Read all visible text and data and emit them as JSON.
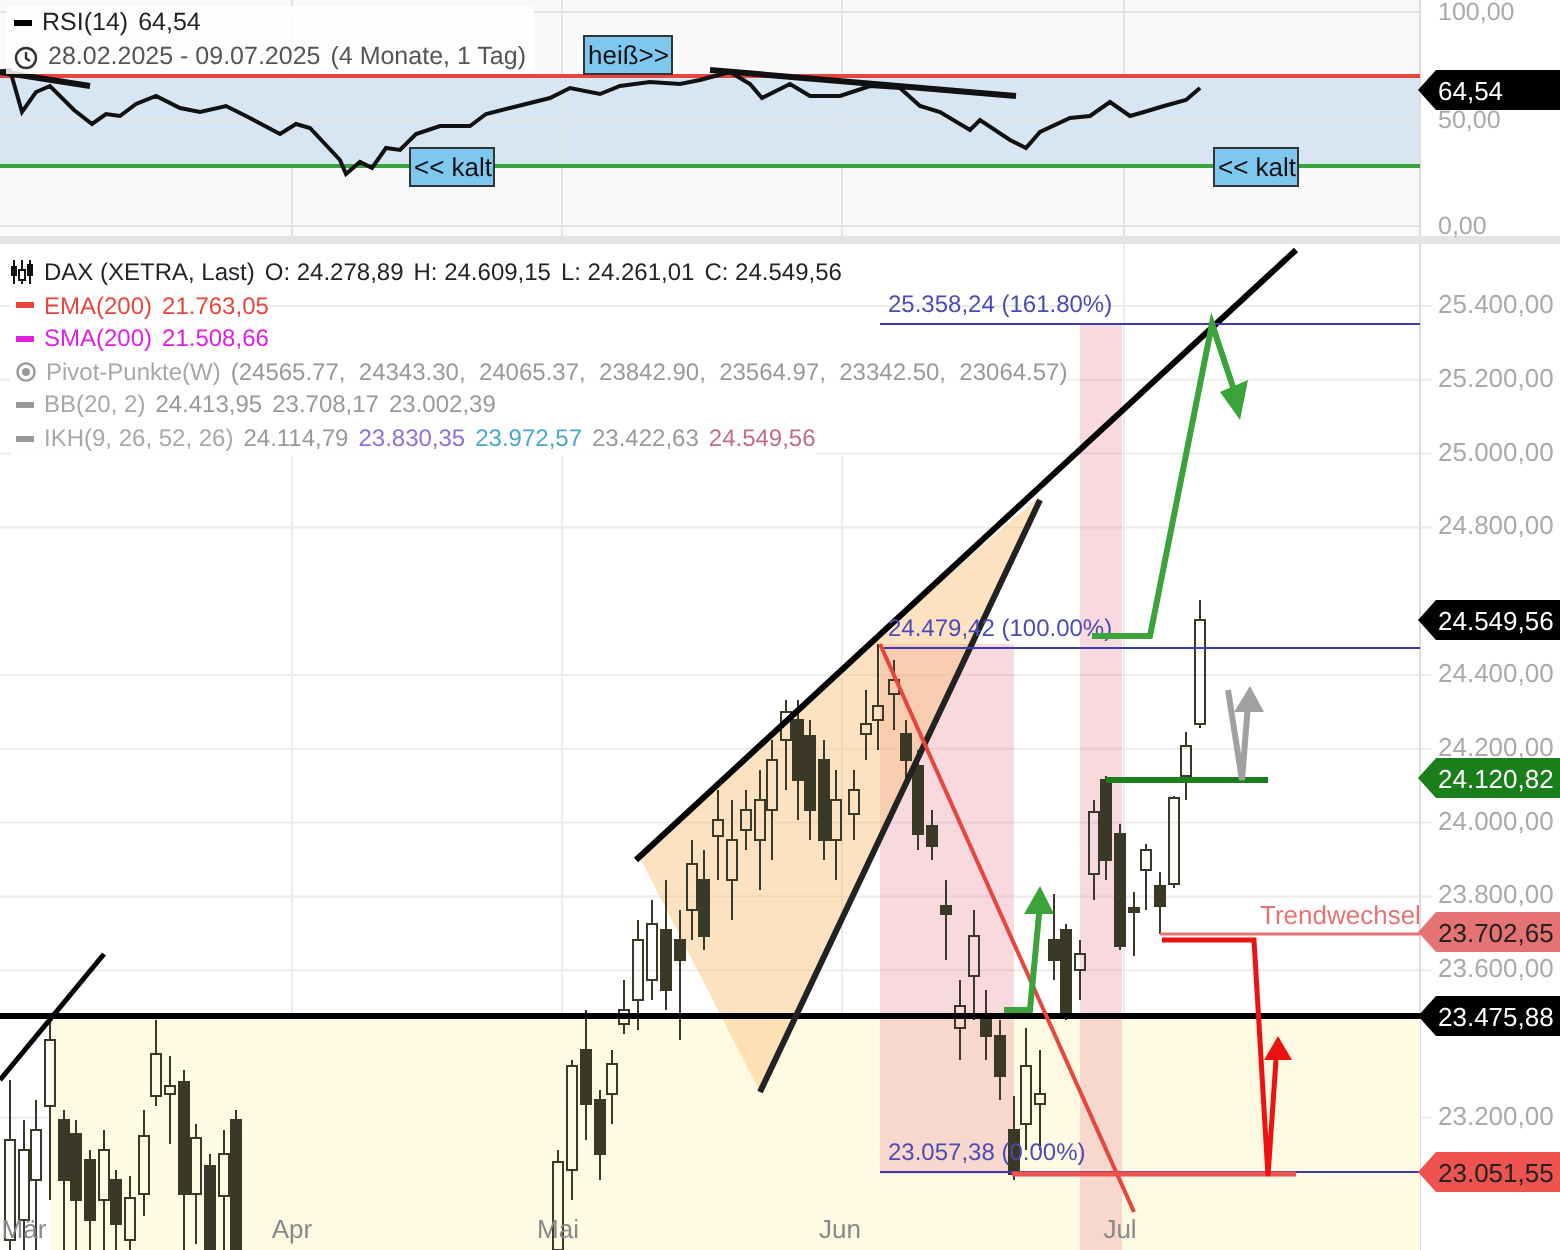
{
  "rsi_panel": {
    "legend": {
      "name": "RSI(14)",
      "value": "64,54"
    },
    "date_range": "28.02.2025 - 09.07.2025",
    "duration": "(4 Monate, 1 Tag)",
    "y_axis": [
      "100,00",
      "50,00",
      "0,00"
    ],
    "current_tag": "64,54",
    "signal_labels": [
      {
        "text": "heiß>>"
      },
      {
        "text": "<< kalt"
      },
      {
        "text": "<< kalt"
      }
    ]
  },
  "price_panel": {
    "instrument": "DAX (XETRA, Last)",
    "ohlc": [
      "O: 24.278,89",
      "H: 24.609,15",
      "L: 24.261,01",
      "C: 24.549,56"
    ],
    "indicators": [
      {
        "kind": "line",
        "name": "EMA(200)",
        "hidden": false,
        "color": "#e8453c",
        "values": [
          {
            "text": "21.763,05",
            "color": "#e8453c"
          }
        ]
      },
      {
        "kind": "line",
        "name": "SMA(200)",
        "hidden": false,
        "color": "#e020e0",
        "values": [
          {
            "text": "21.508,66",
            "color": "#e020e0"
          }
        ]
      },
      {
        "kind": "pivot",
        "name": "Pivot-Punkte(W)",
        "hidden": true,
        "color": "#999999",
        "values": [
          {
            "text": "(24565.77,  24343.30,  24065.37,  23842.90,  23564.97,  23342.50,  23064.57)",
            "color": "#999999"
          }
        ]
      },
      {
        "kind": "line",
        "name": "BB(20, 2)",
        "hidden": true,
        "color": "#999999",
        "values": [
          {
            "text": "24.413,95",
            "color": "#999999"
          },
          {
            "text": "23.708,17",
            "color": "#999999"
          },
          {
            "text": "23.002,39",
            "color": "#999999"
          }
        ]
      },
      {
        "kind": "line",
        "name": "IKH(9, 26, 52, 26)",
        "hidden": true,
        "color": "#999999",
        "values": [
          {
            "text": "24.114,79",
            "color": "#999999"
          },
          {
            "text": "23.830,35",
            "color": "#8f6fdc"
          },
          {
            "text": "23.972,57",
            "color": "#4aa8c8"
          },
          {
            "text": "23.422,63",
            "color": "#999999"
          },
          {
            "text": "24.549,56",
            "color": "#c56a8e"
          }
        ]
      }
    ],
    "fib_levels": [
      "25.358,24 (161.80%)",
      "24.479,42 (100.00%)",
      "23.057,38 (0.00%)"
    ],
    "annotation": "Trendwechsel",
    "y_axis": [
      "25.400,00",
      "25.200,00",
      "25.000,00",
      "24.800,00",
      "24.400,00",
      "24.200,00",
      "24.000,00",
      "23.800,00",
      "23.600,00",
      "23.200,00"
    ],
    "price_tags": [
      {
        "text": "24.549,56",
        "color": "#000000"
      },
      {
        "text": "24.120,82",
        "color": "#1a7f1a"
      },
      {
        "text": "23.702,65",
        "color": "#e57373"
      },
      {
        "text": "23.475,88",
        "color": "#000000"
      },
      {
        "text": "23.051,55",
        "color": "#ef5350"
      }
    ],
    "x_axis": [
      "Mär",
      "Apr",
      "Mai",
      "Jun",
      "Jul"
    ]
  }
}
